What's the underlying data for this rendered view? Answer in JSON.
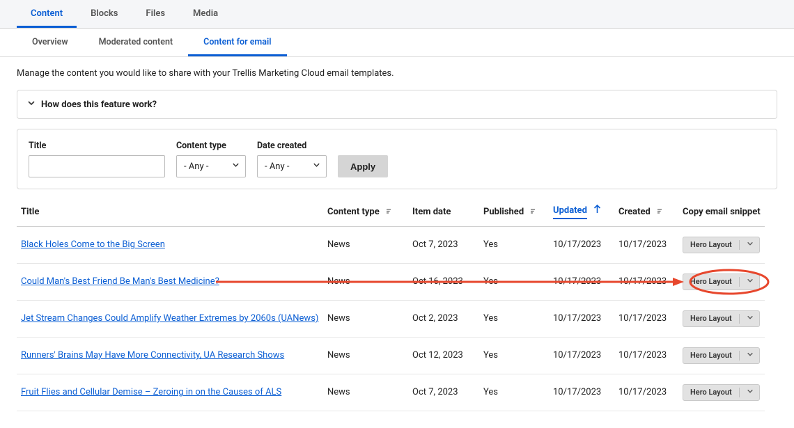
{
  "tabs_primary": {
    "content": "Content",
    "blocks": "Blocks",
    "files": "Files",
    "media": "Media"
  },
  "tabs_secondary": {
    "overview": "Overview",
    "moderated": "Moderated content",
    "email": "Content for email"
  },
  "intro": "Manage the content you would like to share with your Trellis Marketing Cloud email templates.",
  "accordion": {
    "title": "How does this feature work?"
  },
  "filters": {
    "title_label": "Title",
    "content_type_label": "Content type",
    "content_type_value": "- Any -",
    "date_created_label": "Date created",
    "date_created_value": "- Any -",
    "apply": "Apply"
  },
  "columns": {
    "title": "Title",
    "content_type": "Content type",
    "item_date": "Item date",
    "published": "Published",
    "updated": "Updated",
    "created": "Created",
    "snippet": "Copy email snippet"
  },
  "snippet_button_label": "Hero Layout",
  "rows": [
    {
      "title": "Black Holes Come to the Big Screen",
      "type": "News",
      "item_date": "Oct 7, 2023",
      "published": "Yes",
      "updated": "10/17/2023",
      "created": "10/17/2023"
    },
    {
      "title": "Could Man's Best Friend Be Man's Best Medicine?",
      "type": "News",
      "item_date": "Oct 16, 2023",
      "published": "Yes",
      "updated": "10/17/2023",
      "created": "10/17/2023"
    },
    {
      "title": "Jet Stream Changes Could Amplify Weather Extremes by 2060s (UANews)",
      "type": "News",
      "item_date": "Oct 2, 2023",
      "published": "Yes",
      "updated": "10/17/2023",
      "created": "10/17/2023"
    },
    {
      "title": "Runners' Brains May Have More Connectivity, UA Research Shows",
      "type": "News",
      "item_date": "Oct 12, 2023",
      "published": "Yes",
      "updated": "10/17/2023",
      "created": "10/17/2023"
    },
    {
      "title": "Fruit Flies and Cellular Demise – Zeroing in on the Causes of ALS",
      "type": "News",
      "item_date": "Oct 7, 2023",
      "published": "Yes",
      "updated": "10/17/2023",
      "created": "10/17/2023"
    }
  ]
}
